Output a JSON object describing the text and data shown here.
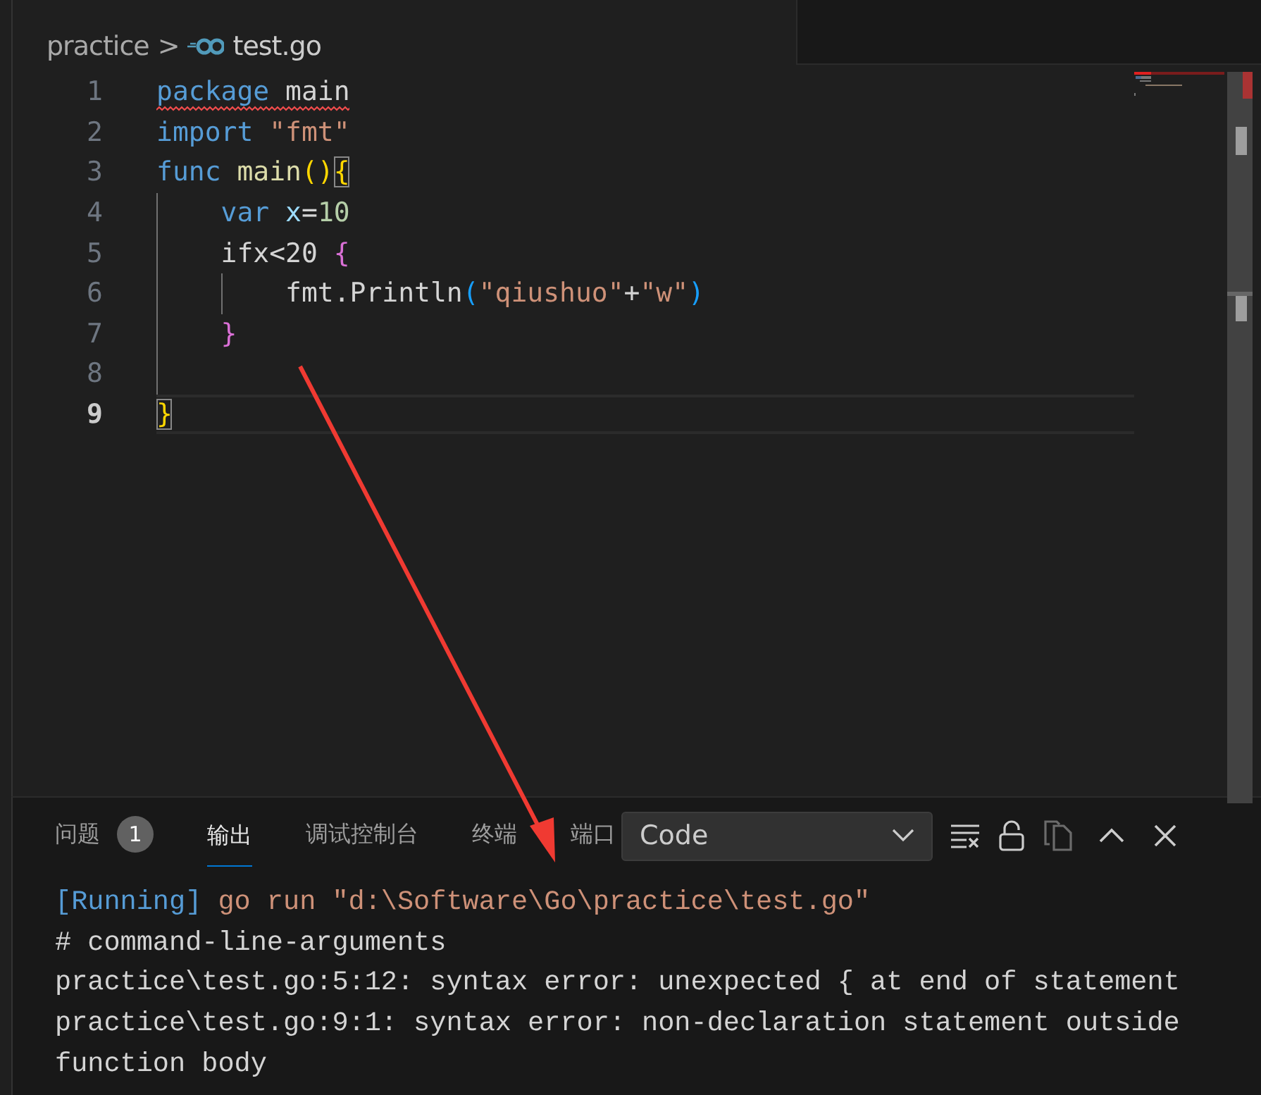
{
  "breadcrumb": {
    "folder": "practice",
    "separator": ">",
    "file": "test.go"
  },
  "editor": {
    "lines": [
      {
        "number": "1",
        "current": false,
        "error": true,
        "tokens": [
          {
            "text": "package",
            "kind": "keyword"
          },
          {
            "text": " main",
            "kind": "plain"
          }
        ]
      },
      {
        "number": "2",
        "current": false,
        "error": false,
        "tokens": [
          {
            "text": "import",
            "kind": "keyword"
          },
          {
            "text": " \"fmt\"",
            "kind": "string"
          }
        ]
      },
      {
        "number": "3",
        "current": false,
        "error": false,
        "tokens": [
          {
            "text": "func",
            "kind": "keyword"
          },
          {
            "text": " main",
            "kind": "func"
          },
          {
            "text": "()",
            "kind": "bracket1"
          },
          {
            "text": "{",
            "kind": "bracket1-match"
          }
        ]
      },
      {
        "number": "4",
        "current": false,
        "error": false,
        "tokens": [
          {
            "text": "    var",
            "kind": "keyword"
          },
          {
            "text": " x",
            "kind": "var"
          },
          {
            "text": "=",
            "kind": "plain"
          },
          {
            "text": "10",
            "kind": "number"
          }
        ]
      },
      {
        "number": "5",
        "current": false,
        "error": false,
        "tokens": [
          {
            "text": "    ifx<20",
            "kind": "plain"
          },
          {
            "text": " {",
            "kind": "bracket2"
          }
        ]
      },
      {
        "number": "6",
        "current": false,
        "error": false,
        "tokens": [
          {
            "text": "        fmt.Println",
            "kind": "plain"
          },
          {
            "text": "(",
            "kind": "bracket3"
          },
          {
            "text": "\"qiushuo\"",
            "kind": "string"
          },
          {
            "text": "+",
            "kind": "plain"
          },
          {
            "text": "\"w\"",
            "kind": "string"
          },
          {
            "text": ")",
            "kind": "bracket3"
          }
        ]
      },
      {
        "number": "7",
        "current": false,
        "error": false,
        "tokens": [
          {
            "text": "    }",
            "kind": "bracket2"
          }
        ]
      },
      {
        "number": "8",
        "current": false,
        "error": false
      },
      {
        "number": "9",
        "current": true,
        "error": false,
        "tokens": [
          {
            "text": "}",
            "kind": "bracket1-match"
          }
        ]
      }
    ]
  },
  "panel": {
    "tabs": [
      {
        "label": "问题",
        "badge": "1",
        "selected": false
      },
      {
        "label": "输出",
        "selected": true
      },
      {
        "label": "调试控制台",
        "selected": false
      },
      {
        "label": "终端",
        "selected": false
      },
      {
        "label": "端口",
        "selected": false
      }
    ],
    "channel_select": {
      "value": "Code"
    },
    "output": [
      [
        {
          "text": "[Running]",
          "kind": "info"
        },
        {
          "text": " go run \"d:\\Software\\Go\\practice\\test.go\"",
          "kind": "command"
        }
      ],
      [
        {
          "text": "# command-line-arguments",
          "kind": "plain"
        }
      ],
      [
        {
          "text": "practice\\test.go:5:12: syntax error: unexpected { at end of statement",
          "kind": "plain"
        }
      ],
      [
        {
          "text": "practice\\test.go:9:1: syntax error: non-declaration statement outside",
          "kind": "plain"
        }
      ],
      [
        {
          "text": "function body",
          "kind": "plain"
        }
      ]
    ]
  }
}
